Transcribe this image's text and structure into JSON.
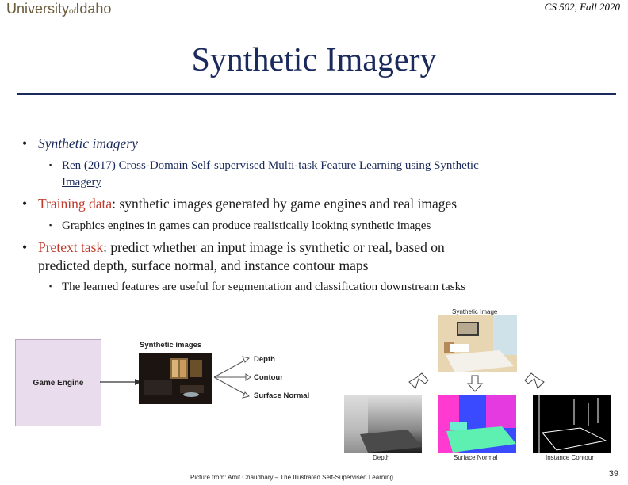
{
  "header": {
    "logo_main": "University",
    "logo_of": "of",
    "logo_end": "Idaho",
    "course": "CS 502, Fall 2020"
  },
  "title": "Synthetic Imagery",
  "bullets": [
    {
      "text": "Synthetic imagery"
    },
    {
      "sub": "Ren (2017) Cross-Domain Self-supervised Multi-task Feature Learning using Synthetic",
      "sub2": "Imagery"
    },
    {
      "lead": "Training data",
      "rest": ": synthetic images generated by game engines and real images"
    },
    {
      "sub": "Graphics engines in games can produce realistically looking synthetic images"
    },
    {
      "lead": "Pretext task",
      "rest": ": predict whether an input image is synthetic or real, based on",
      "line2": "predicted depth, surface normal, and instance contour maps"
    },
    {
      "sub": "The learned features are useful for segmentation and classification downstream tasks"
    }
  ],
  "figure_left": {
    "engine_label": "Game Engine",
    "synthetic_label": "Synthetic images",
    "outputs": [
      "Depth",
      "Contour",
      "Surface Normal"
    ]
  },
  "figure_right": {
    "top_label": "Synthetic Image",
    "bottom_labels": [
      "Depth",
      "Surface Normal",
      "Instance Contour"
    ]
  },
  "caption": "Picture from: Amit Chaudhary – The Illustrated Self-Supervised Learning",
  "page_number": "39",
  "colors": {
    "navy": "#1a2a5c",
    "accent_red": "#c0392b",
    "engine_bg": "#e9dcec"
  }
}
